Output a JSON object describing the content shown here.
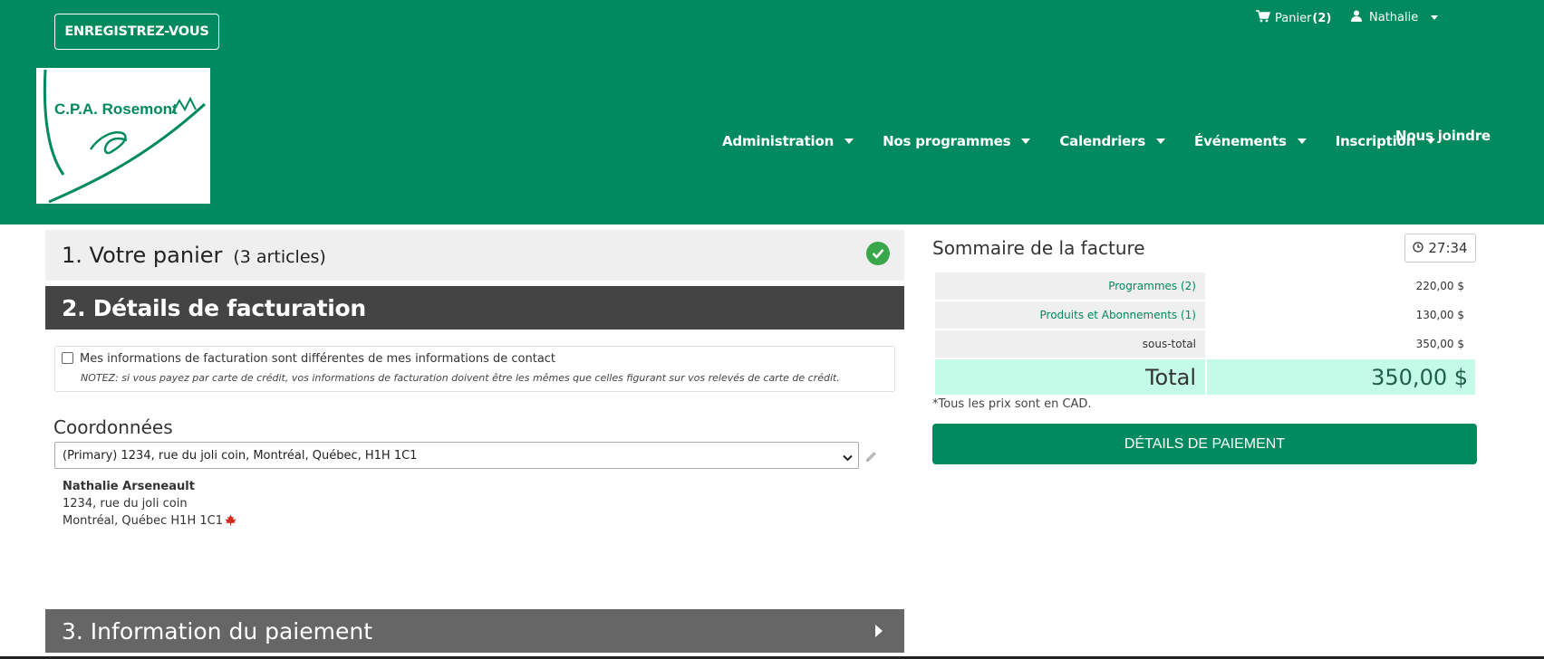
{
  "header": {
    "register_label": "ENREGISTREZ-VOUS",
    "cart_label": "Panier",
    "cart_count": "(2)",
    "user_name": "Nathalie",
    "logo_text": "C.P.A. Rosemont",
    "nav": [
      {
        "label": "Administration"
      },
      {
        "label": "Nos programmes"
      },
      {
        "label": "Calendriers"
      },
      {
        "label": "Événements"
      },
      {
        "label": "Inscription"
      }
    ],
    "nav_join": "Nous joindre",
    "bg_color": "#008a5e"
  },
  "step1": {
    "title": "1. Votre panier",
    "subtitle": "(3 articles)"
  },
  "step2": {
    "title": "2. Détails de facturation",
    "checkbox_label": "Mes informations de facturation sont différentes de mes informations de contact",
    "note": "NOTEZ: si vous payez par carte de crédit, vos informations de facturation doivent être les mêmes que celles figurant sur vos relevés de carte de crédit.",
    "coords_title": "Coordonnées",
    "address_select": "(Primary) 1234, rue du joli coin, Montréal, Québec, H1H 1C1",
    "contact": {
      "name": "Nathalie Arseneault",
      "street": "1234, rue du joli coin",
      "city_line": "Montréal, Québec H1H 1C1"
    }
  },
  "step3": {
    "title": "3. Information du paiement"
  },
  "summary": {
    "title": "Sommaire de la facture",
    "timer": "27:34",
    "rows": [
      {
        "label": "Programmes (2)",
        "value": "220,00 $"
      },
      {
        "label": "Produits et Abonnements (1)",
        "value": "130,00 $"
      },
      {
        "label": "sous-total",
        "value": "350,00 $"
      }
    ],
    "total_label": "Total",
    "total_value": "350,00 $",
    "prices_note": "*Tous les prix sont en CAD.",
    "pay_button": "DÉTAILS DE PAIEMENT"
  }
}
